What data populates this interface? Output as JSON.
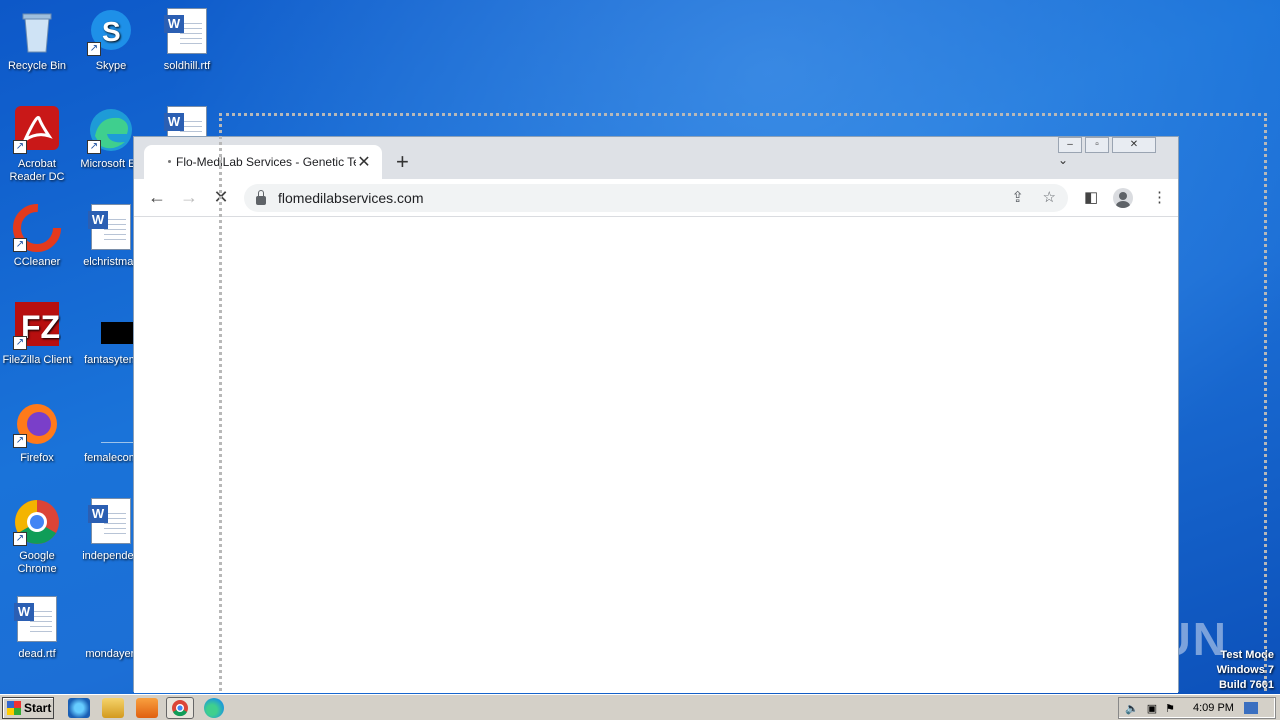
{
  "desktop": {
    "icons": [
      {
        "label": "Recycle Bin",
        "icon": "recycle-bin-icon"
      },
      {
        "label": "Skype",
        "icon": "skype-icon"
      },
      {
        "label": "soldhill.rtf",
        "icon": "word-document-icon"
      },
      {
        "label": "Acrobat Reader DC",
        "icon": "acrobat-icon"
      },
      {
        "label": "Microsoft Ed",
        "icon": "edge-icon"
      },
      {
        "label": "CCleaner",
        "icon": "ccleaner-icon"
      },
      {
        "label": "elchristmas",
        "icon": "word-document-icon"
      },
      {
        "label": "FileZilla Client",
        "icon": "filezilla-icon"
      },
      {
        "label": "fantasytem",
        "icon": "black-file-icon"
      },
      {
        "label": "Firefox",
        "icon": "firefox-icon"
      },
      {
        "label": "femalecom",
        "icon": "blank-file-icon"
      },
      {
        "label": "Google Chrome",
        "icon": "chrome-icon"
      },
      {
        "label": "independen",
        "icon": "word-document-icon"
      },
      {
        "label": "dead.rtf",
        "icon": "word-document-icon"
      },
      {
        "label": "mondayeri",
        "icon": "blank-file-icon"
      }
    ]
  },
  "browser": {
    "tab_title": "Flo-MediLab Services - Genetic Tests",
    "url": "flomedilabservices.com"
  },
  "watermark": "ANY RUN",
  "test_mode": {
    "line1": "Test Mode",
    "line2": "Windows 7",
    "line3": "Build 7601"
  },
  "taskbar": {
    "start_label": "Start",
    "clock": "4:09 PM"
  }
}
